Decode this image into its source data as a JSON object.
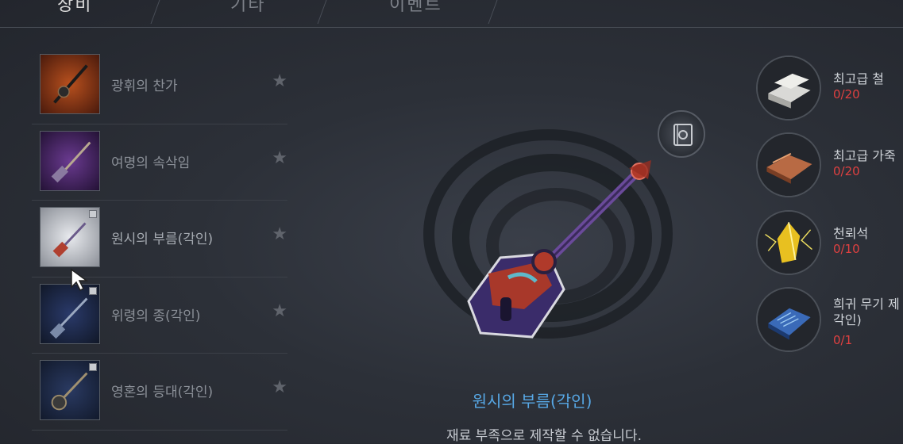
{
  "tabs": [
    {
      "label": "장비"
    },
    {
      "label": "기타"
    },
    {
      "label": "이벤트"
    }
  ],
  "recipes": [
    {
      "name": "광휘의 찬가"
    },
    {
      "name": "여명의 속삭임"
    },
    {
      "name": "원시의 부름(각인)"
    },
    {
      "name": "위령의 종(각인)"
    },
    {
      "name": "영혼의 등대(각인)"
    }
  ],
  "selected_item": {
    "title": "원시의 부름(각인)",
    "status": "재료 부족으로 제작할 수 없습니다."
  },
  "materials": [
    {
      "name": "최고급 철",
      "count": "0/20"
    },
    {
      "name": "최고급 가죽",
      "count": "0/20"
    },
    {
      "name": "천뢰석",
      "count": "0/10"
    },
    {
      "name_line1": "희귀 무기 제",
      "name_line2": "각인)",
      "count": "0/1"
    }
  ],
  "colors": {
    "title_blue": "#57a8e6",
    "count_red": "#e04040",
    "background": "#2c3038"
  }
}
